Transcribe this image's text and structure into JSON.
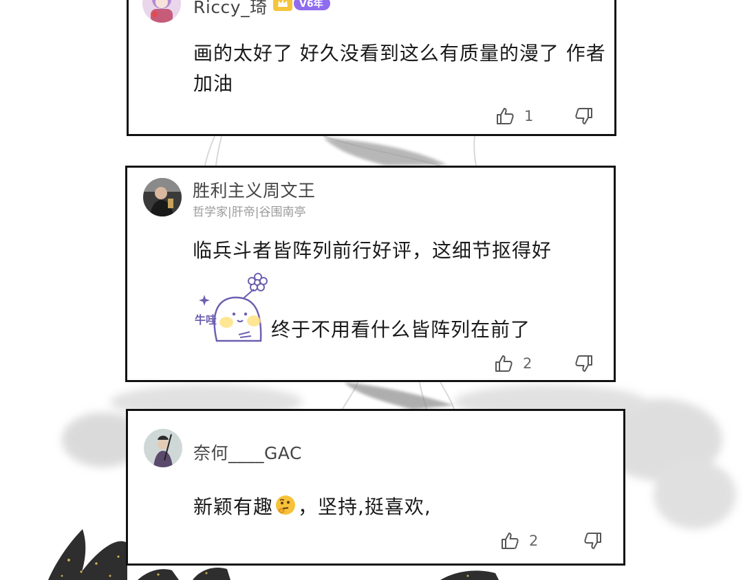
{
  "comments": [
    {
      "username": "Riccy_琦",
      "badge": {
        "level": "V6年"
      },
      "text": "画的太好了 好久没看到这么有质量的漫了 作者加油",
      "likes": "1",
      "avatar_icon": "avatar-anime-girl"
    },
    {
      "username": "胜利主义周文王",
      "tags": "哲学家|肝帝|谷围南亭",
      "text": "临兵斗者皆阵列前行好评，这细节抠得好",
      "sticker": {
        "text": "牛哇",
        "icon": "ghost-sticker"
      },
      "sticker_caption": "终于不用看什么皆阵列在前了",
      "likes": "2",
      "avatar_icon": "avatar-dark-figure"
    },
    {
      "username": "奈何____GAC",
      "text_before_emoji": "新颖有趣",
      "emoji": "thinking-face",
      "text_after_emoji": "，坚持,挺喜欢,",
      "likes": "2",
      "avatar_icon": "avatar-swordsman"
    }
  ],
  "colors": {
    "card_border": "#111111",
    "badge_gold": "#f5c43b",
    "badge_purple": "#8f6cf0",
    "tag_gray": "#9a9a9a"
  }
}
